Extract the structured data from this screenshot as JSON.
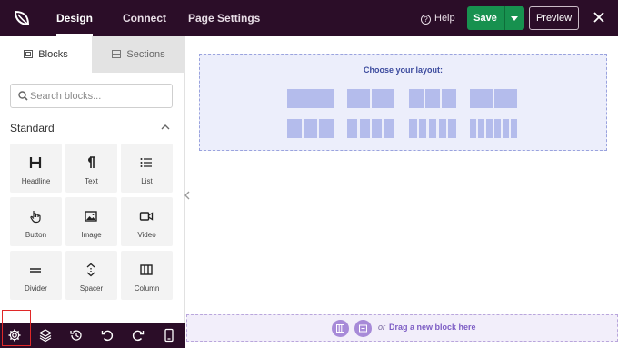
{
  "topbar": {
    "tabs": [
      {
        "label": "Design",
        "active": true
      },
      {
        "label": "Connect",
        "active": false
      },
      {
        "label": "Page Settings",
        "active": false
      }
    ],
    "help_label": "Help",
    "save_label": "Save",
    "preview_label": "Preview"
  },
  "sidebar": {
    "tabs": [
      {
        "label": "Blocks",
        "active": true
      },
      {
        "label": "Sections",
        "active": false
      }
    ],
    "search_placeholder": "Search blocks...",
    "section_title": "Standard",
    "blocks": [
      {
        "label": "Headline",
        "icon": "headline-icon"
      },
      {
        "label": "Text",
        "icon": "paragraph-icon"
      },
      {
        "label": "List",
        "icon": "list-icon"
      },
      {
        "label": "Button",
        "icon": "pointer-icon"
      },
      {
        "label": "Image",
        "icon": "image-icon"
      },
      {
        "label": "Video",
        "icon": "video-icon"
      },
      {
        "label": "Divider",
        "icon": "divider-icon"
      },
      {
        "label": "Spacer",
        "icon": "spacer-icon"
      },
      {
        "label": "Column",
        "icon": "column-icon"
      }
    ]
  },
  "toolbar": {
    "icons": [
      "settings-icon",
      "layers-icon",
      "history-icon",
      "undo-icon",
      "redo-icon",
      "mobile-preview-icon"
    ],
    "highlighted": "settings-icon"
  },
  "canvas": {
    "layout_title": "Choose your layout:",
    "layouts": [
      {
        "columns": [
          1
        ]
      },
      {
        "columns": [
          1,
          1
        ]
      },
      {
        "columns": [
          1,
          1,
          1
        ]
      },
      {
        "columns": [
          1,
          1
        ]
      },
      {
        "columns": [
          1,
          1,
          1
        ]
      },
      {
        "columns": [
          1,
          1,
          1,
          1
        ]
      },
      {
        "columns": [
          1,
          1,
          1,
          1,
          1
        ]
      },
      {
        "columns": [
          1,
          1,
          1,
          1,
          1,
          1
        ]
      }
    ],
    "drop_or": "or",
    "drop_text": "Drag a new block here"
  },
  "colors": {
    "topbar_bg": "#2b0d28",
    "save_green": "#17914f",
    "layout_fill": "#b4bcec",
    "drop_accent": "#7c5cc4",
    "highlight_red": "#e02828"
  }
}
